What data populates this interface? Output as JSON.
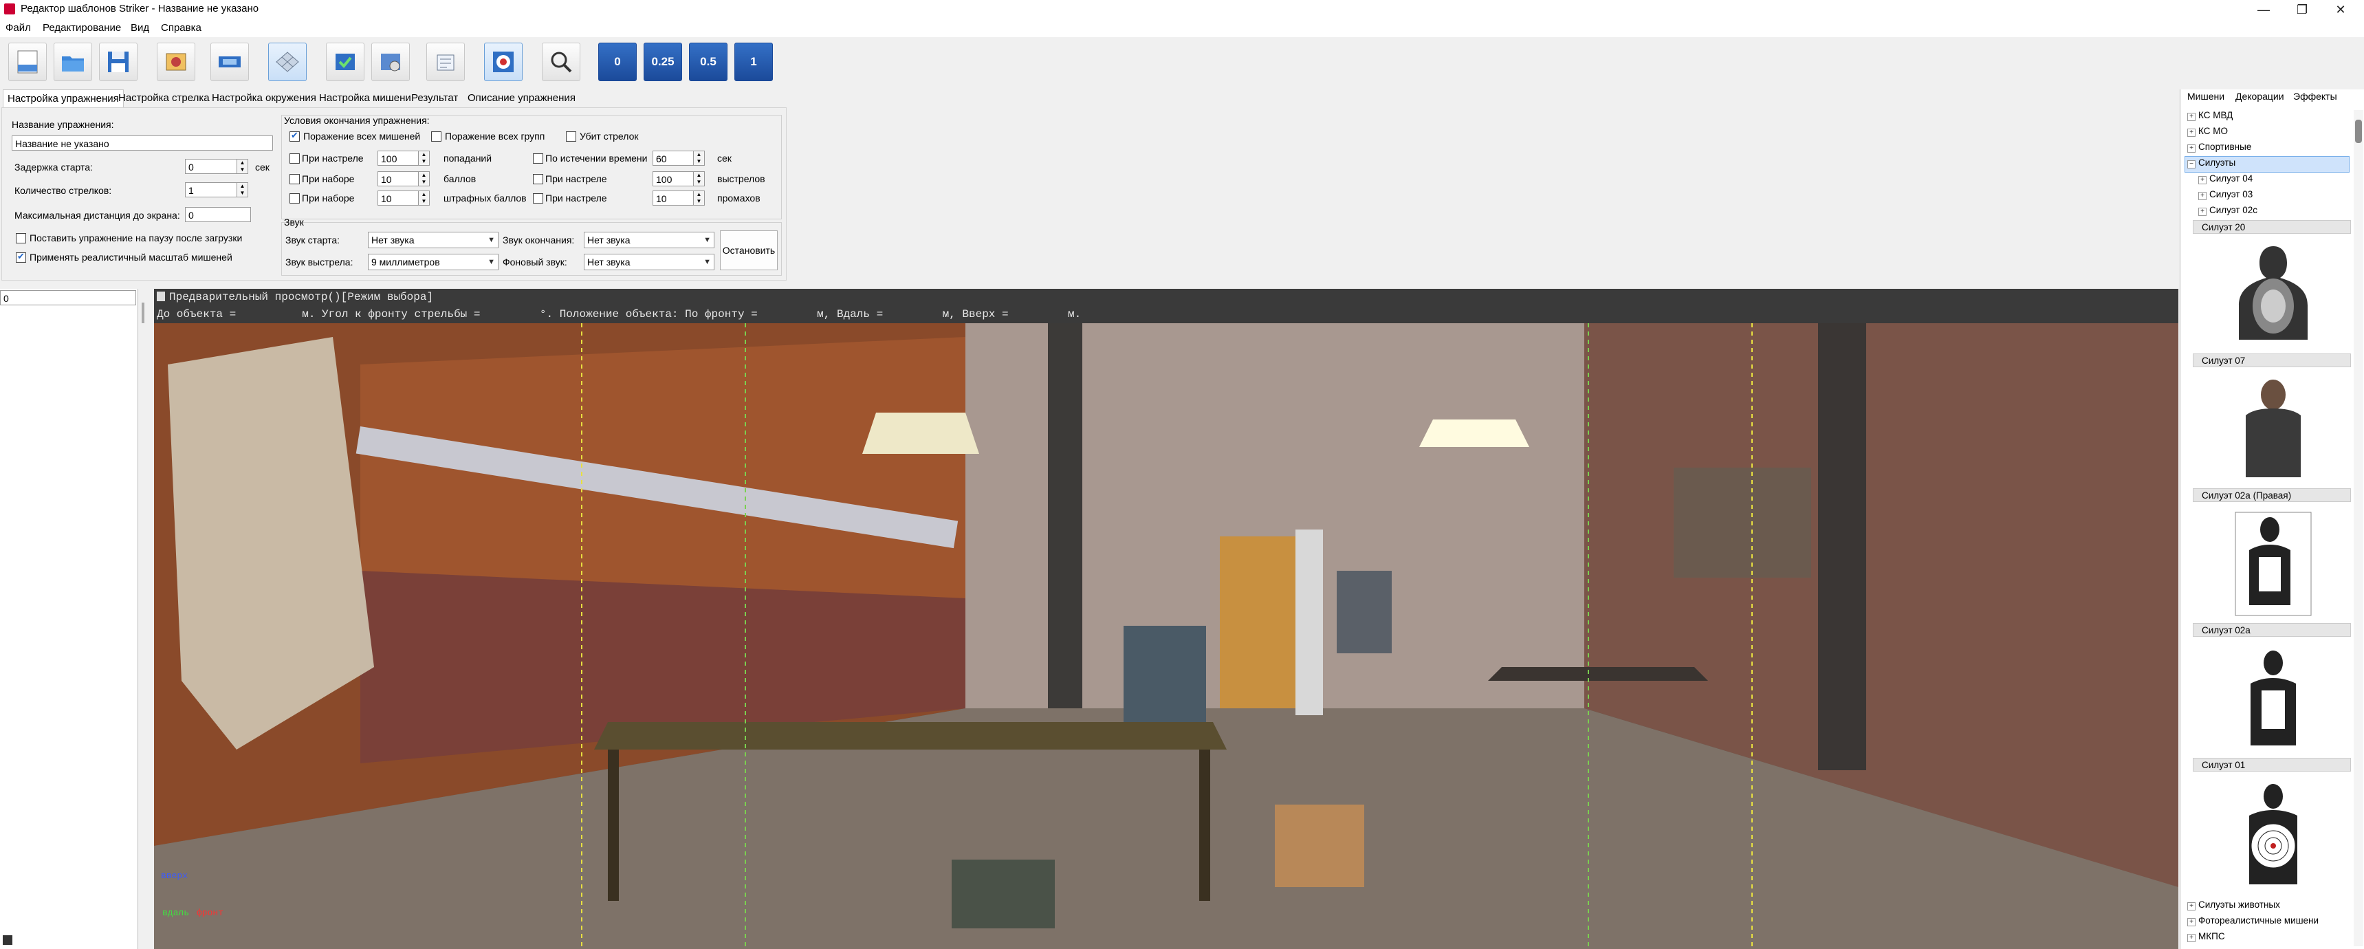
{
  "window": {
    "title": "Редактор шаблонов Striker - Название не указано"
  },
  "menu": [
    "Файл",
    "Редактирование",
    "Вид",
    "Справка"
  ],
  "toolbar": {
    "buttons": [
      "new-icon",
      "open-icon",
      "save-icon",
      "tools-icon",
      "shooter-icon",
      "grid-icon",
      "check-icon",
      "settings-icon",
      "print-icon",
      "target-icon",
      "zoom-icon"
    ],
    "number_buttons": [
      "0",
      "0.25",
      "0.5",
      "1"
    ]
  },
  "tabs": [
    "Настройка упражнения",
    "Настройка стрелка",
    "Настройка окружения",
    "Настройка мишени",
    "Результат",
    "Описание упражнения"
  ],
  "exercise": {
    "name_label": "Название упражнения:",
    "name_value": "Название не указано",
    "start_delay_label": "Задержка старта:",
    "start_delay_value": "0",
    "start_delay_unit": "сек",
    "shooters_label": "Количество стрелков:",
    "shooters_value": "1",
    "max_distance_label": "Максимальная дистанция до экрана:",
    "max_distance_value": "0",
    "pause_label": "Поставить упражнение на паузу после загрузки",
    "realistic_label": "Применять реалистичный масштаб мишеней"
  },
  "end_conditions": {
    "title": "Условия окончания упражнения:",
    "all_targets": "Поражение всех мишеней",
    "all_groups": "Поражение всех групп",
    "shooter_killed": "Убит стрелок",
    "rows": [
      {
        "label": "При настреле",
        "value": "100",
        "unit": "попаданий"
      },
      {
        "label": "При наборе",
        "value": "10",
        "unit": "баллов"
      },
      {
        "label": "При наборе",
        "value": "10",
        "unit": "штрафных баллов"
      }
    ],
    "rows2": [
      {
        "label": "По истечении времени",
        "value": "60",
        "unit": "сек"
      },
      {
        "label": "При настреле",
        "value": "100",
        "unit": "выстрелов"
      },
      {
        "label": "При настреле",
        "value": "10",
        "unit": "промахов"
      }
    ]
  },
  "sound": {
    "title": "Звук",
    "start_label": "Звук старта:",
    "start_value": "Нет звука",
    "end_label": "Звук окончания:",
    "end_value": "Нет звука",
    "shot_label": "Звук выстрела:",
    "shot_value": "9 миллиметров",
    "bg_label": "Фоновый звук:",
    "bg_value": "Нет звука",
    "stop_button": "Остановить"
  },
  "left_list": {
    "input_value": "0"
  },
  "preview": {
    "title": "Предварительный просмотр()[Режим выбора]",
    "status": "До объекта =          м. Угол к фронту стрельбы =         °. Положение объекта: По фронту =         м, Вдаль =         м, Вверх =         м.",
    "legend": [
      "вверх",
      "вдаль",
      "фронт"
    ]
  },
  "right_panel": {
    "tabs": [
      "Мишени",
      "Декорации",
      "Эффекты"
    ],
    "tree_top": [
      "КС МВД",
      "КС МО",
      "Спортивные",
      "Силуэты"
    ],
    "tree_sub": [
      "Силуэт 04",
      "Силуэт 03",
      "Силуэт 02с",
      "Силуэт 20"
    ],
    "thumb_labels": [
      "Силуэт 07",
      "Силуэт 02а (Правая)",
      "Силуэт 02а",
      "Силуэт 01"
    ],
    "tree_bottom": [
      "Силуэты животных",
      "Фотореалистичные мишени",
      "МКПС"
    ]
  },
  "colors": {
    "accent": "#1f64c8",
    "preview_header": "#3a3a3a",
    "selected": "#cfe3fb"
  }
}
